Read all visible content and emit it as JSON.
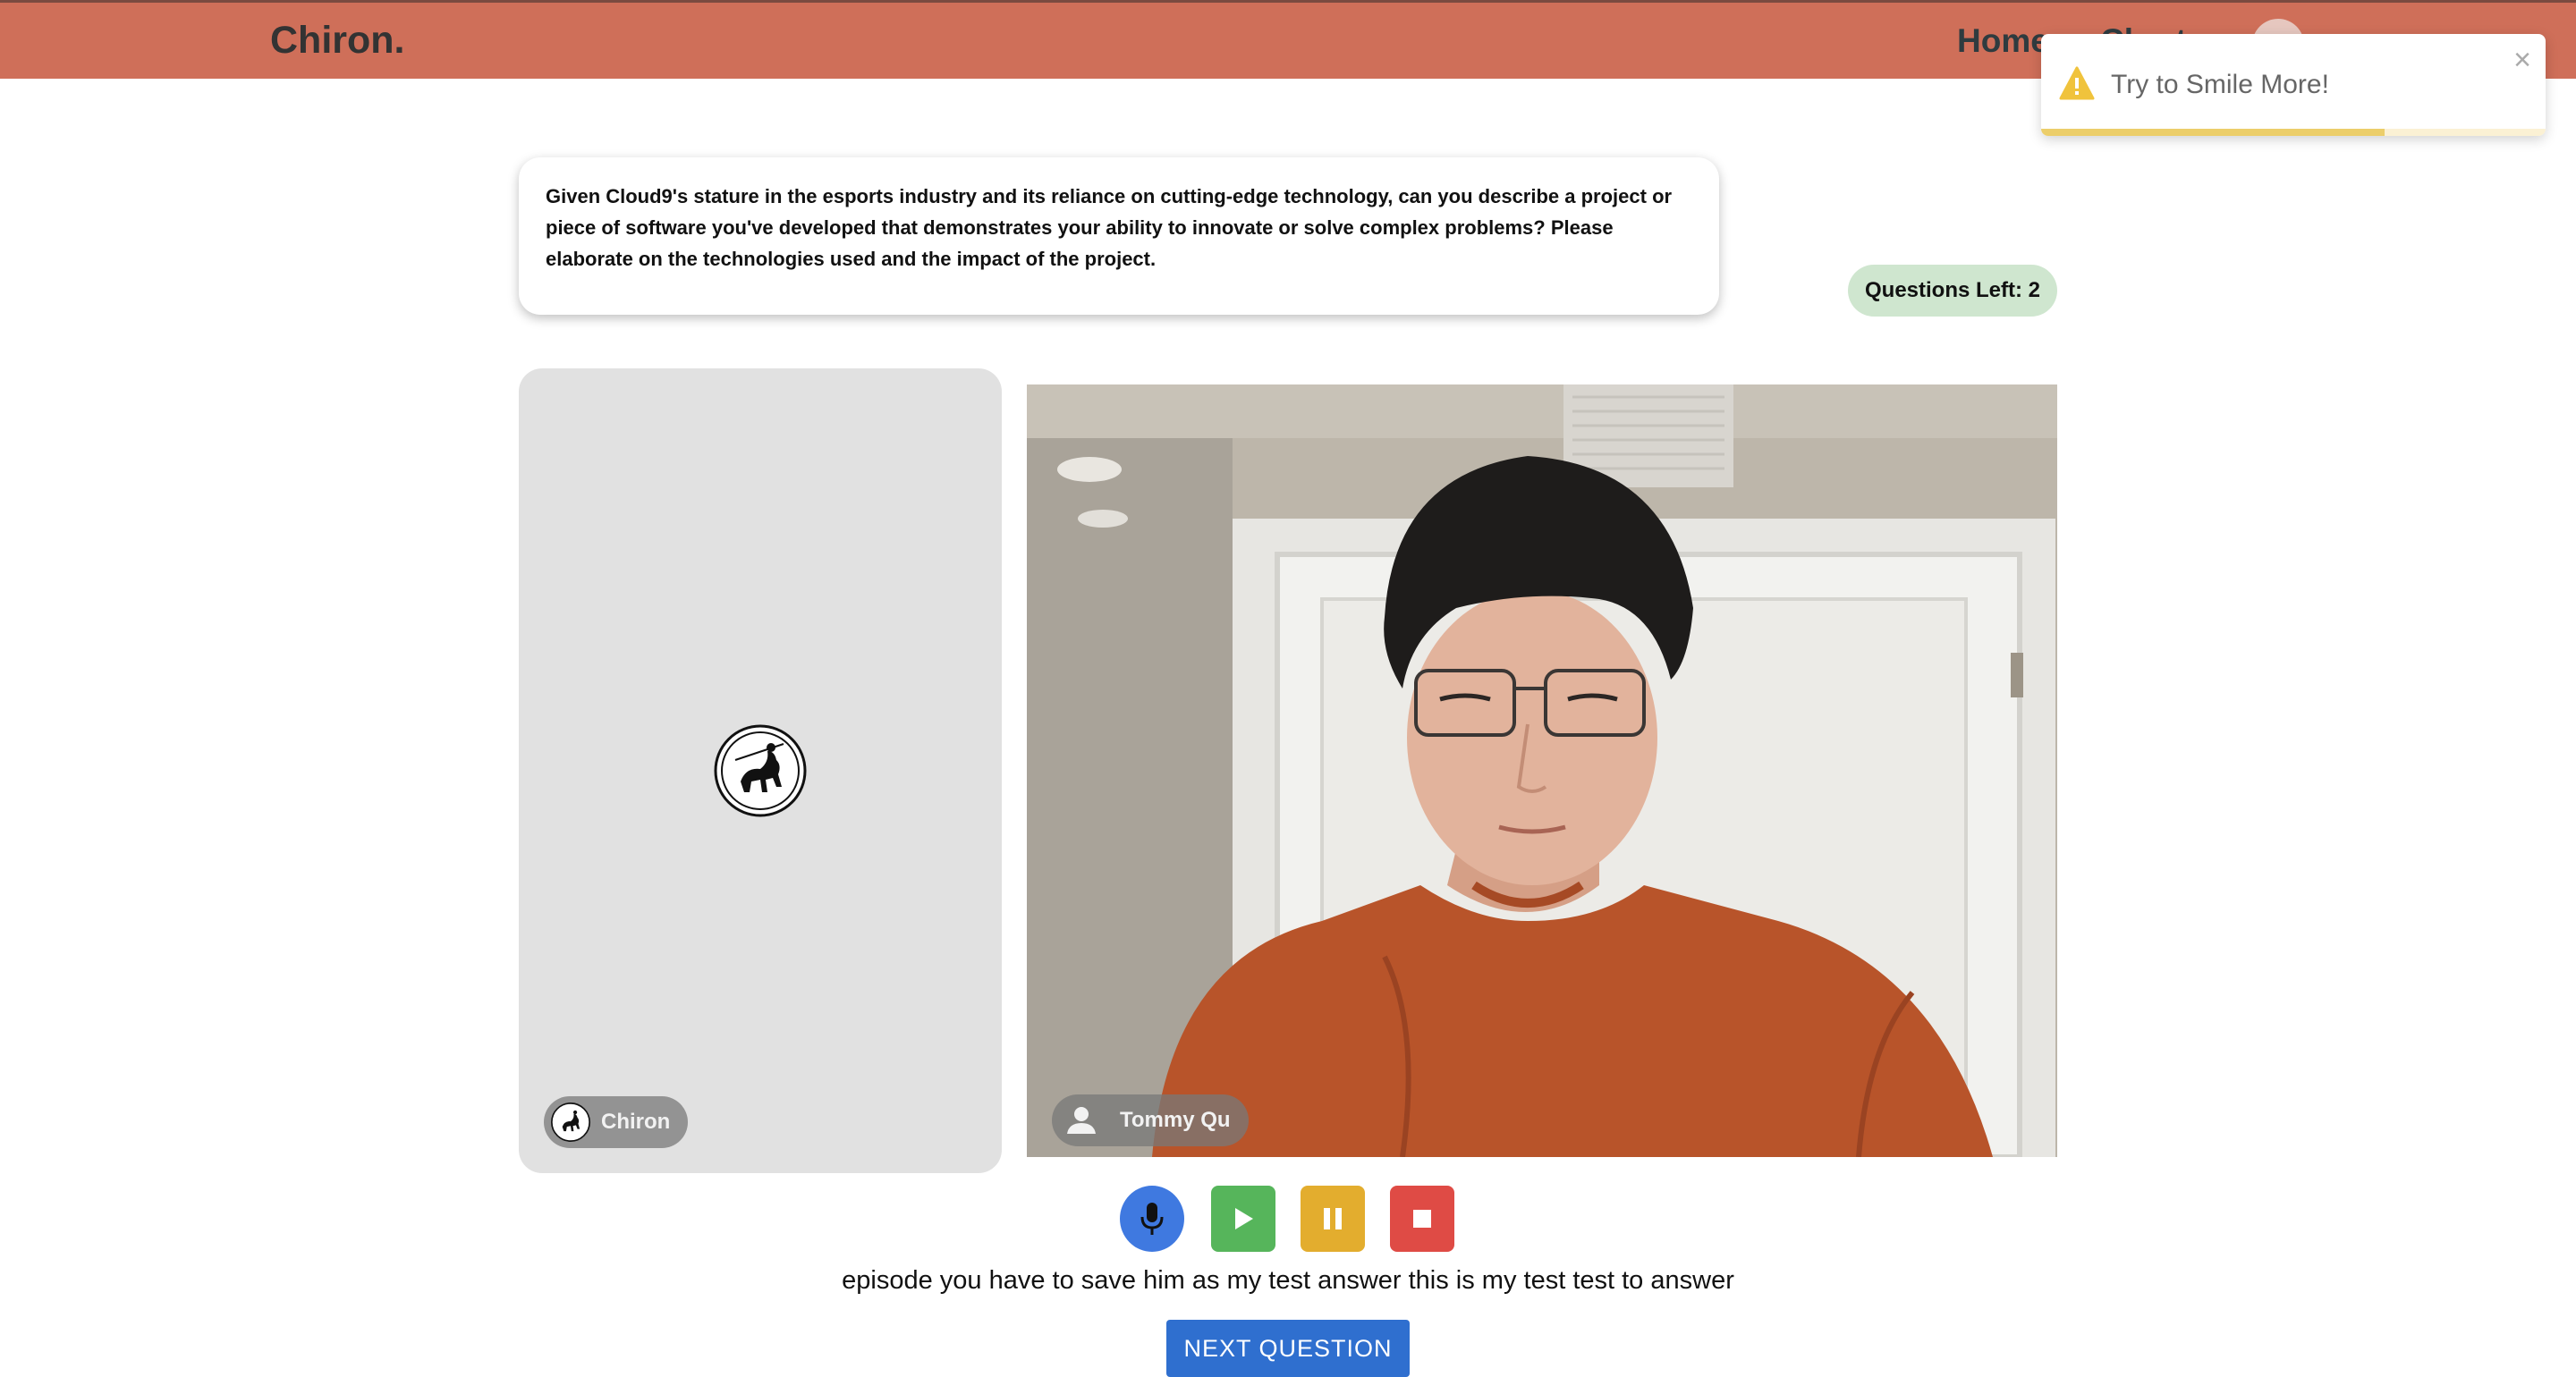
{
  "navbar": {
    "brand": "Chiron.",
    "links": [
      "Home",
      "Charts"
    ]
  },
  "toast": {
    "message": "Try to Smile More!",
    "close_symbol": "×",
    "progress": 0.68,
    "icon": "warning-icon",
    "color": "#f0c33c"
  },
  "question": {
    "text": "Given Cloud9's stature in the esports industry and its reliance on cutting-edge technology, can you describe a project or piece of software you've developed that demonstrates your ability to innovate or solve complex problems? Please elaborate on the technologies used and the impact of the project."
  },
  "questions_left": "Questions Left: 2",
  "participants": {
    "interviewer": "Chiron",
    "candidate": "Tommy Qu"
  },
  "controls": {
    "icons": [
      "microphone-icon",
      "play-icon",
      "pause-icon",
      "stop-icon"
    ],
    "colors": {
      "mic": "#3f79e0",
      "play": "#56b55b",
      "pause": "#e3ad2e",
      "stop": "#df4b45"
    }
  },
  "transcript": "episode you have to save him as my test answer this is my test test to answer",
  "next_button": "NEXT QUESTION",
  "colors": {
    "navbar": "#cf6f59",
    "accent": "#2f6fcf"
  }
}
